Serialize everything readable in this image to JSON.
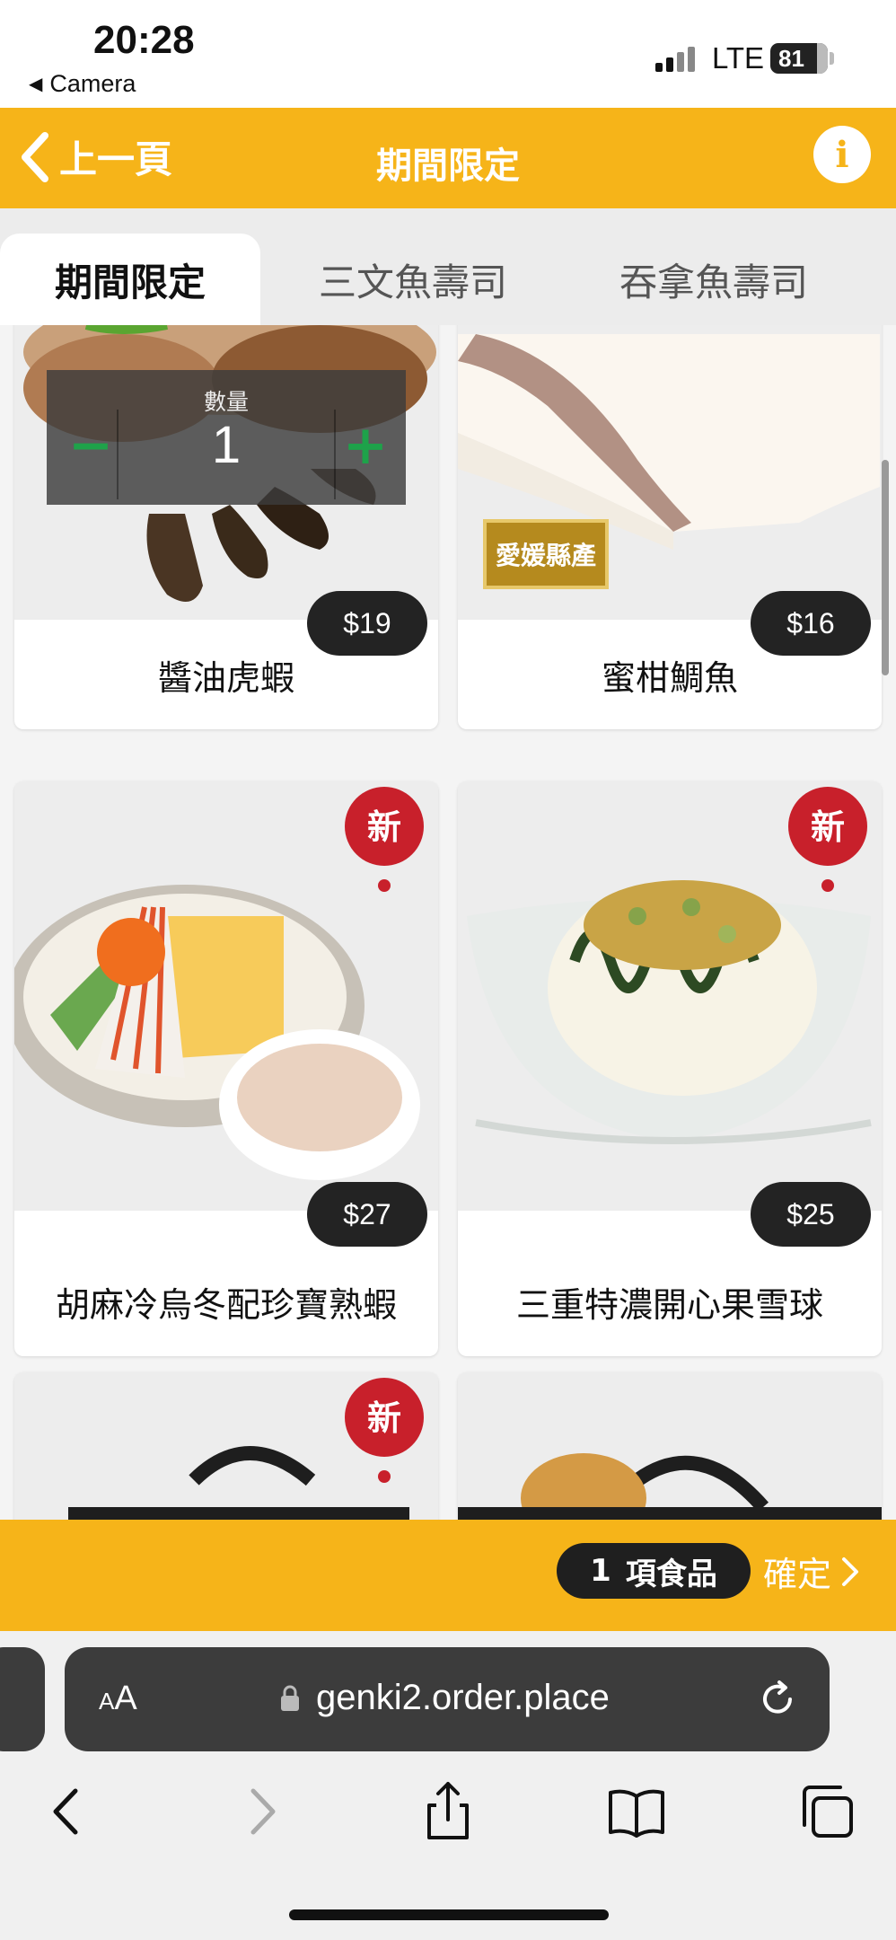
{
  "status_bar": {
    "time": "20:28",
    "back_app": "Camera",
    "network": "LTE",
    "battery": "81"
  },
  "header": {
    "back_label": "上一頁",
    "title": "期間限定",
    "info_label": "i"
  },
  "tabs": [
    {
      "label": "期間限定",
      "active": true
    },
    {
      "label": "三文魚壽司",
      "active": false
    },
    {
      "label": "吞拿魚壽司",
      "active": false
    }
  ],
  "quantity_overlay": {
    "label": "數量",
    "value": "1",
    "minus": "−",
    "plus": "+"
  },
  "items": [
    {
      "name": "醬油虎蝦",
      "price": "$19"
    },
    {
      "name": "蜜柑鯛魚",
      "price": "$16",
      "tag": "愛媛縣產"
    },
    {
      "name": "胡麻冷烏冬配珍寶熟蝦",
      "price": "$27",
      "badge": "新"
    },
    {
      "name": "三重特濃開心果雪球",
      "price": "$25",
      "badge": "新"
    },
    {
      "badge": "新"
    }
  ],
  "order_bar": {
    "count": "1",
    "count_label": "項食品",
    "confirm_label": "確定"
  },
  "browser": {
    "aa_small": "A",
    "aa_large": "A",
    "url": "genki2.order.place"
  },
  "colors": {
    "brand": "#f6b419",
    "badge_red": "#c8202b",
    "price_bg": "#232323"
  }
}
